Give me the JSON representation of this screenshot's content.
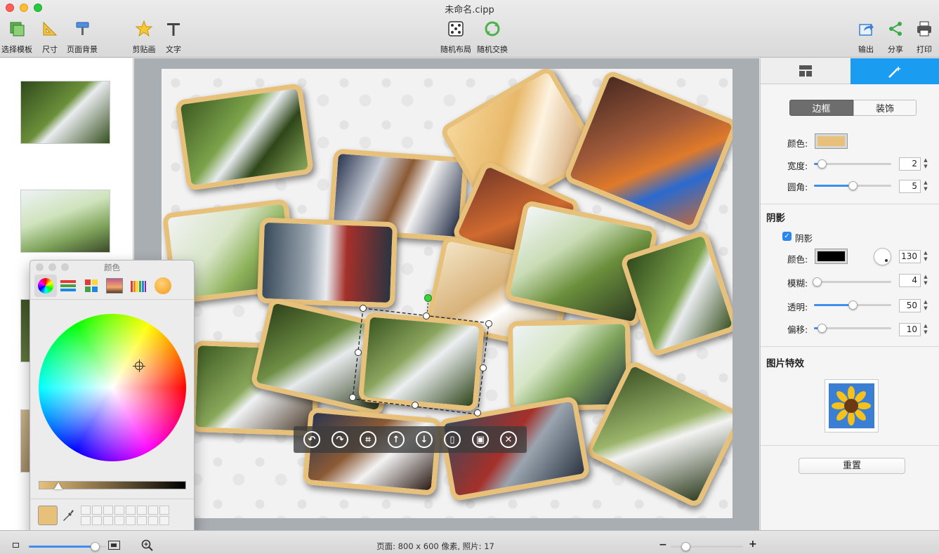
{
  "window": {
    "title": "未命名.cipp"
  },
  "toolbar": {
    "left": [
      {
        "label": "选择模板",
        "icon": "template-icon"
      },
      {
        "label": "尺寸",
        "icon": "ruler-icon"
      },
      {
        "label": "页面背景",
        "icon": "paint-roller-icon"
      },
      {
        "label": "剪贴画",
        "icon": "star-icon"
      },
      {
        "label": "文字",
        "icon": "text-icon"
      }
    ],
    "center": [
      {
        "label": "随机布局",
        "icon": "dice-icon"
      },
      {
        "label": "随机交换",
        "icon": "shuffle-icon"
      }
    ],
    "right": [
      {
        "label": "输出",
        "icon": "export-icon"
      },
      {
        "label": "分享",
        "icon": "share-icon"
      },
      {
        "label": "打印",
        "icon": "print-icon"
      }
    ]
  },
  "right_panel": {
    "tabs": [
      {
        "icon": "layout-icon"
      },
      {
        "icon": "magic-wand-icon"
      }
    ],
    "segment": {
      "border": "边框",
      "decoration": "装饰"
    },
    "border": {
      "color_label": "颜色:",
      "color": "#e7c07a",
      "width_label": "宽度:",
      "width_value": "2",
      "width_level": 0.1,
      "radius_label": "圆角:",
      "radius_value": "5",
      "radius_level": 0.5
    },
    "shadow": {
      "section_title": "阴影",
      "checkbox_label": "阴影",
      "checked": true,
      "color_label": "颜色:",
      "color": "#000000",
      "angle_value": "130",
      "blur_label": "模糊:",
      "blur_value": "4",
      "blur_level": 0.04,
      "opacity_label": "透明:",
      "opacity_value": "50",
      "opacity_level": 0.5,
      "offset_label": "偏移:",
      "offset_value": "10",
      "offset_level": 0.1
    },
    "effects": {
      "section_title": "图片特效",
      "preview_icon": "sunflower-icon"
    },
    "reset_label": "重置"
  },
  "color_panel": {
    "title": "颜色",
    "modes": [
      "color-wheel-icon",
      "sliders-icon",
      "palettes-icon",
      "image-palette-icon",
      "crayons-icon",
      "orange-swatch-icon"
    ],
    "selected_color": "#e7c07a"
  },
  "float_toolbar": {
    "buttons": [
      "rotate-left-icon",
      "rotate-right-icon",
      "crop-icon",
      "bring-forward-icon",
      "send-backward-icon",
      "flip-icon",
      "fit-icon",
      "delete-icon"
    ]
  },
  "status": {
    "text": "页面: 800 x 600 像素, 照片: 17",
    "zoom_level": 0.85,
    "page_zoom_level": 0.2
  }
}
